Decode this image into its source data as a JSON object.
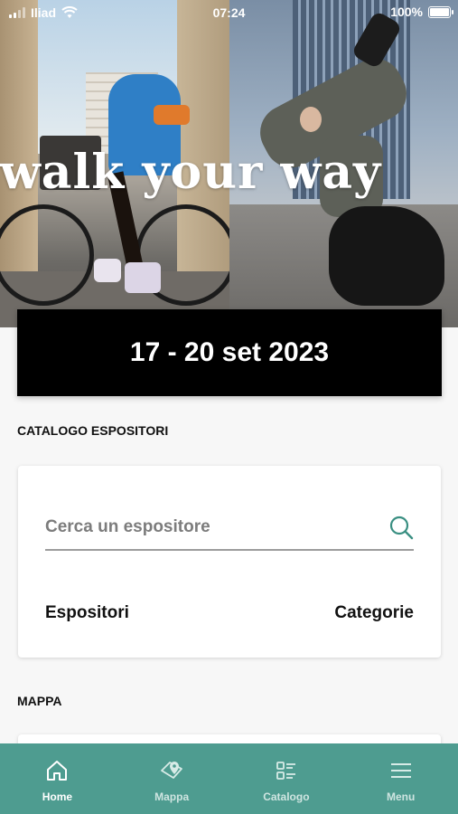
{
  "status_bar": {
    "carrier": "Iliad",
    "time": "07:24",
    "battery": "100%"
  },
  "hero": {
    "tagline": "walk your way"
  },
  "event": {
    "dates": "17 - 20 set 2023"
  },
  "catalog": {
    "section_title": "CATALOGO ESPOSITORI",
    "search_placeholder": "Cerca un espositore",
    "exhibitors_label": "Espositori",
    "categories_label": "Categorie"
  },
  "map": {
    "section_title": "MAPPA"
  },
  "bottom_nav": {
    "items": [
      {
        "label": "Home",
        "icon": "home-icon",
        "active": true
      },
      {
        "label": "Mappa",
        "icon": "map-icon",
        "active": false
      },
      {
        "label": "Catalogo",
        "icon": "catalog-icon",
        "active": false
      },
      {
        "label": "Menu",
        "icon": "menu-icon",
        "active": false
      }
    ]
  },
  "colors": {
    "nav_background": "#4e9c90",
    "accent": "#3a8f82",
    "banner": "#000000"
  }
}
